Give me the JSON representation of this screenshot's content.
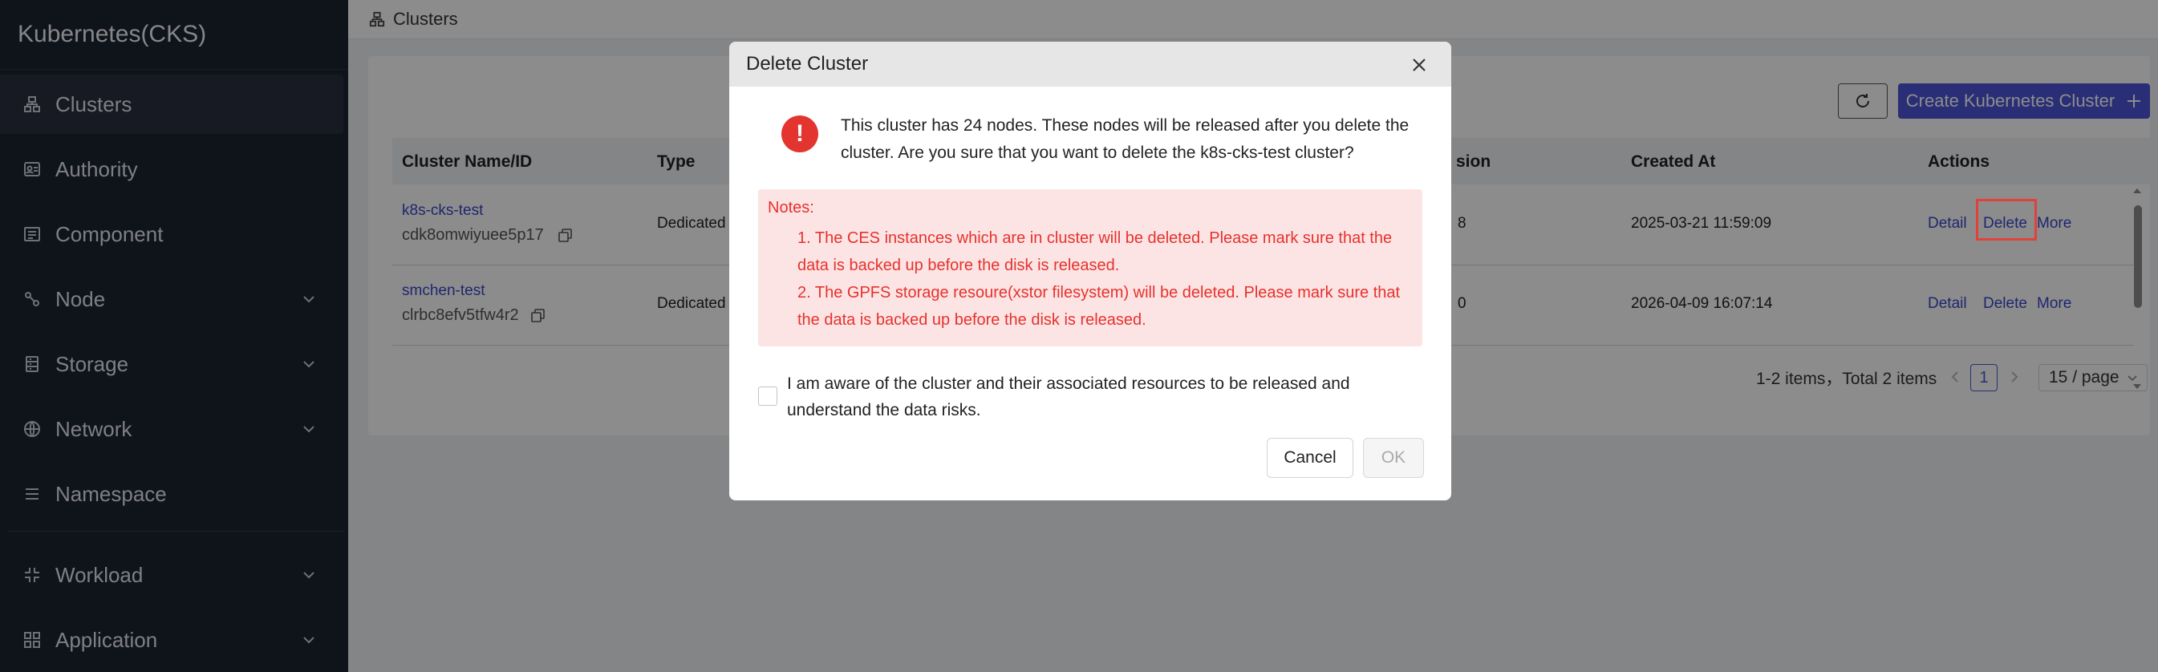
{
  "app": {
    "title": "Kubernetes(CKS)"
  },
  "sidebar": {
    "items": [
      {
        "label": "Clusters",
        "icon": "cluster-icon",
        "active": true
      },
      {
        "label": "Authority",
        "icon": "authority-icon"
      },
      {
        "label": "Component",
        "icon": "component-icon"
      },
      {
        "label": "Node",
        "icon": "node-icon",
        "expandable": true
      },
      {
        "label": "Storage",
        "icon": "storage-icon",
        "expandable": true
      },
      {
        "label": "Network",
        "icon": "network-icon",
        "expandable": true
      },
      {
        "label": "Namespace",
        "icon": "namespace-icon"
      },
      {
        "label": "Workload",
        "icon": "workload-icon",
        "expandable": true
      },
      {
        "label": "Application",
        "icon": "application-icon",
        "expandable": true
      }
    ]
  },
  "breadcrumb": {
    "label": "Clusters"
  },
  "toolbar": {
    "create_label": "Create Kubernetes Cluster",
    "create_icon": "plus-icon",
    "refresh_icon": "refresh-icon"
  },
  "table": {
    "headers": {
      "name": "Cluster Name/ID",
      "type": "Type",
      "version": "sion",
      "created": "Created At",
      "actions": "Actions"
    },
    "rows": [
      {
        "name": "k8s-cks-test",
        "id": "cdk8omwiyuee5p17",
        "type": "Dedicated",
        "version": "8",
        "created": "2025-03-21 11:59:09",
        "detail": "Detail",
        "delete": "Delete",
        "more": "More"
      },
      {
        "name": "smchen-test",
        "id": "clrbc8efv5tfw4r2",
        "type": "Dedicated",
        "version": "0",
        "created": "2026-04-09 16:07:14",
        "detail": "Detail",
        "delete": "Delete",
        "more": "More"
      }
    ]
  },
  "pagination": {
    "summary": "1-2 items，Total 2 items",
    "current": "1",
    "page_size": "15 / page"
  },
  "modal": {
    "title": "Delete Cluster",
    "message": "This cluster has 24 nodes. These nodes will be released after you delete the cluster. Are you sure that you want to delete the k8s-cks-test cluster?",
    "notes_title": "Notes:",
    "note1": "1. The CES instances which are in cluster will be deleted. Please mark sure that the data is backed up before the disk is released.",
    "note2": "2. The GPFS storage resoure(xstor filesystem) will be deleted. Please mark sure that the data is backed up before the disk is released.",
    "warn_symbol": "!",
    "checkbox_label": "I am aware of the cluster and their associated resources to be released and understand the data risks.",
    "cancel_label": "Cancel",
    "ok_label": "OK"
  },
  "colors": {
    "sidebar_bg": "#1d2331",
    "primary": "#4d55d8",
    "danger": "#e3342f",
    "link": "#3a46c8"
  }
}
